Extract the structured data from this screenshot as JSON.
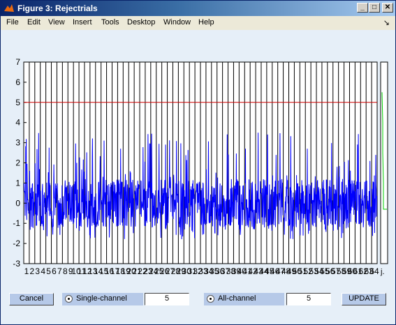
{
  "window": {
    "title": "Figure 3: Rejectrials",
    "min_glyph": "_",
    "max_glyph": "□",
    "close_glyph": "✕"
  },
  "menu": {
    "items": [
      "File",
      "Edit",
      "View",
      "Insert",
      "Tools",
      "Desktop",
      "Window",
      "Help"
    ],
    "corner_glyph": "↘"
  },
  "controls": {
    "cancel_label": "Cancel",
    "single_channel_label": "Single-channel",
    "single_channel_value": "5",
    "all_channel_label": "All-channel",
    "all_channel_value": "5",
    "update_label": "UPDATE"
  },
  "chart_data": {
    "type": "line",
    "ylim": [
      -3,
      7
    ],
    "yticks": [
      "-3",
      "-2",
      "-1",
      "0",
      "1",
      "2",
      "3",
      "4",
      "5",
      "6",
      "7"
    ],
    "xticks": [
      "1",
      "2",
      "3",
      "4",
      "5",
      "6",
      "7",
      "8",
      "9",
      "10",
      "11",
      "12",
      "13",
      "14",
      "15",
      "16",
      "17",
      "18",
      "19",
      "20",
      "21",
      "22",
      "23",
      "24",
      "25",
      "26",
      "27",
      "28",
      "29",
      "30",
      "31",
      "32",
      "33",
      "34",
      "35",
      "36",
      "37",
      "38",
      "39",
      "40",
      "41",
      "42",
      "43",
      "44",
      "45",
      "46",
      "47",
      "48",
      "49",
      "50",
      "51",
      "52",
      "53",
      "54",
      "55",
      "56",
      "57",
      "58",
      "59",
      "60",
      "61",
      "62",
      "63",
      "64"
    ],
    "threshold": 5,
    "trial_count": 64,
    "signal_color": "#0000ff",
    "threshold_color": "#cc0000",
    "side_panel_color": "#00cc00",
    "side_panel_label": "j."
  }
}
